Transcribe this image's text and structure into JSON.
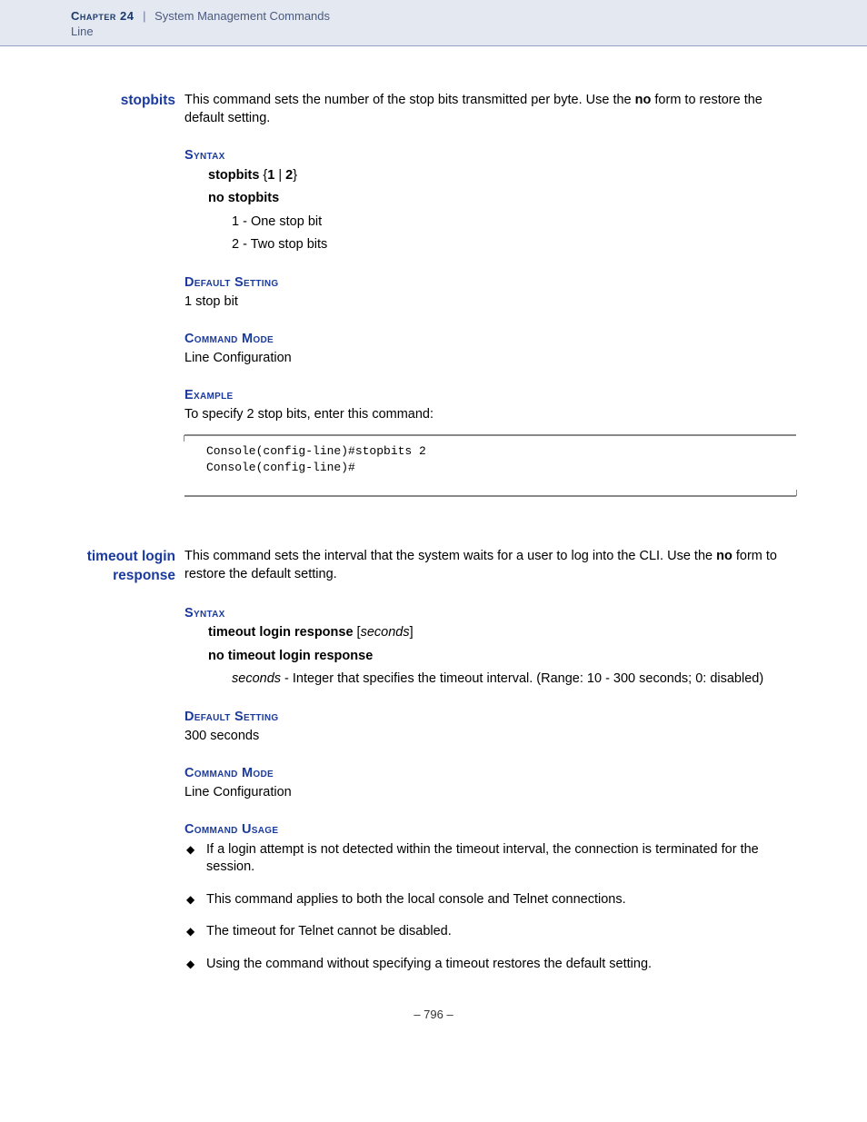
{
  "header": {
    "chapter": "Chapter 24",
    "separator": "|",
    "title": "System Management Commands",
    "subtitle": "Line"
  },
  "cmd1": {
    "name": "stopbits",
    "desc_pre": "This command sets the number of the stop bits transmitted per byte. Use the ",
    "desc_bold": "no",
    "desc_post": " form to restore the default setting.",
    "syntax_head": "Syntax",
    "syntax_l1_b": "stopbits",
    "syntax_l1_rest": " {1 | 2}",
    "syntax_l2": "no stopbits",
    "syntax_sub1": "1 - One stop bit",
    "syntax_sub2": "2 - Two stop bits",
    "default_head": "Default Setting",
    "default_body": "1 stop bit",
    "mode_head": "Command Mode",
    "mode_body": "Line Configuration",
    "example_head": "Example",
    "example_body": "To specify 2 stop bits, enter this command:",
    "code": "Console(config-line)#stopbits 2\nConsole(config-line)#"
  },
  "cmd2": {
    "name": "timeout login response",
    "desc_pre": "This command sets the interval that the system waits for a user to log into the CLI. Use the ",
    "desc_bold": "no",
    "desc_post": " form to restore the default setting.",
    "syntax_head": "Syntax",
    "syntax_l1_b": "timeout login response",
    "syntax_l1_br1": " [",
    "syntax_l1_it": "seconds",
    "syntax_l1_br2": "]",
    "syntax_l2": "no timeout login response",
    "syntax_sub_it": "seconds",
    "syntax_sub_rest": " - Integer that specifies the timeout interval. (Range: 10 - 300 seconds; 0: disabled)",
    "default_head": "Default Setting",
    "default_body": "300 seconds",
    "mode_head": "Command Mode",
    "mode_body": "Line Configuration",
    "usage_head": "Command Usage",
    "usage_items": [
      "If a login attempt is not detected within the timeout interval, the connection is terminated for the session.",
      "This command applies to both the local console and Telnet connections.",
      "The timeout for Telnet cannot be disabled.",
      "Using the command without specifying a timeout restores the default setting."
    ]
  },
  "page_num": "– 796 –"
}
